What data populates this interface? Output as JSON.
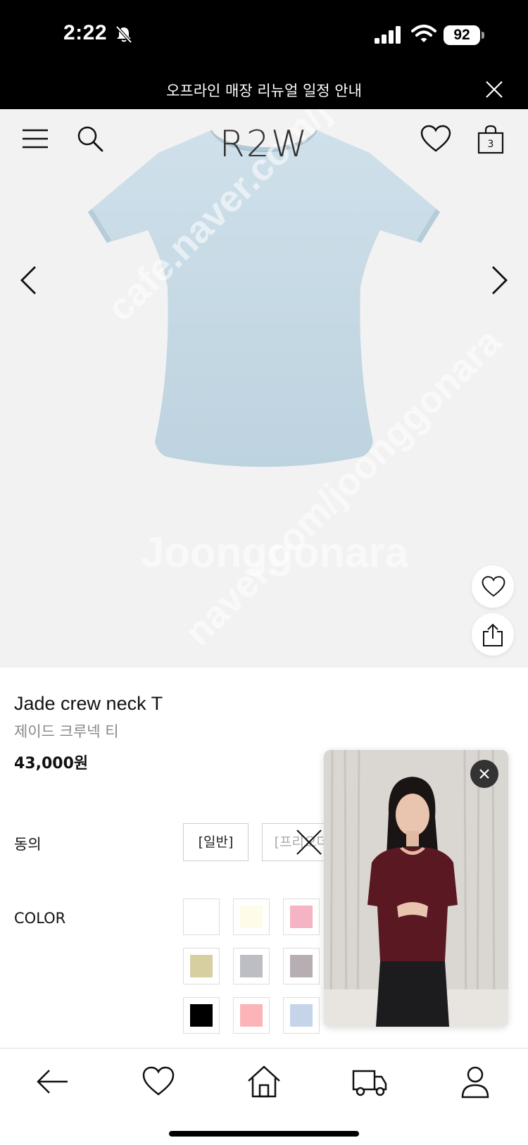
{
  "status_bar": {
    "time": "2:22",
    "battery": "92"
  },
  "notice": {
    "text": "오프라인 매장 리뉴얼 일정 안내"
  },
  "header": {
    "brand": "R2W",
    "cart_count": "3"
  },
  "watermarks": [
    "cafe.naver.com/joonggonara",
    "Joonggonara",
    "naver.com/joonggonara"
  ],
  "product": {
    "name": "Jade crew neck T",
    "name_ko": "제이드 크루넥 티",
    "price": "43,000원"
  },
  "options": {
    "consent_label": "동의",
    "consent_choices": [
      "[일반]",
      "[프리오더]"
    ],
    "color_label": "COLOR",
    "colors": [
      "#ffffff",
      "#fefbe8",
      "#f6b3c3",
      "#d8cfa1",
      "#bcbec3",
      "#b6aeb2",
      "#000000",
      "#fbb4b8",
      "#c5d4e8"
    ]
  },
  "colors": {
    "tshirt": "#c8dbe6",
    "banner": "#000000",
    "hero_bg": "#f2f2f2"
  },
  "icons": [
    "menu-icon",
    "search-icon",
    "heart-icon",
    "bag-icon",
    "chevron-left-icon",
    "chevron-right-icon",
    "share-icon",
    "back-arrow-icon",
    "home-icon",
    "truck-icon",
    "user-icon",
    "close-icon"
  ]
}
